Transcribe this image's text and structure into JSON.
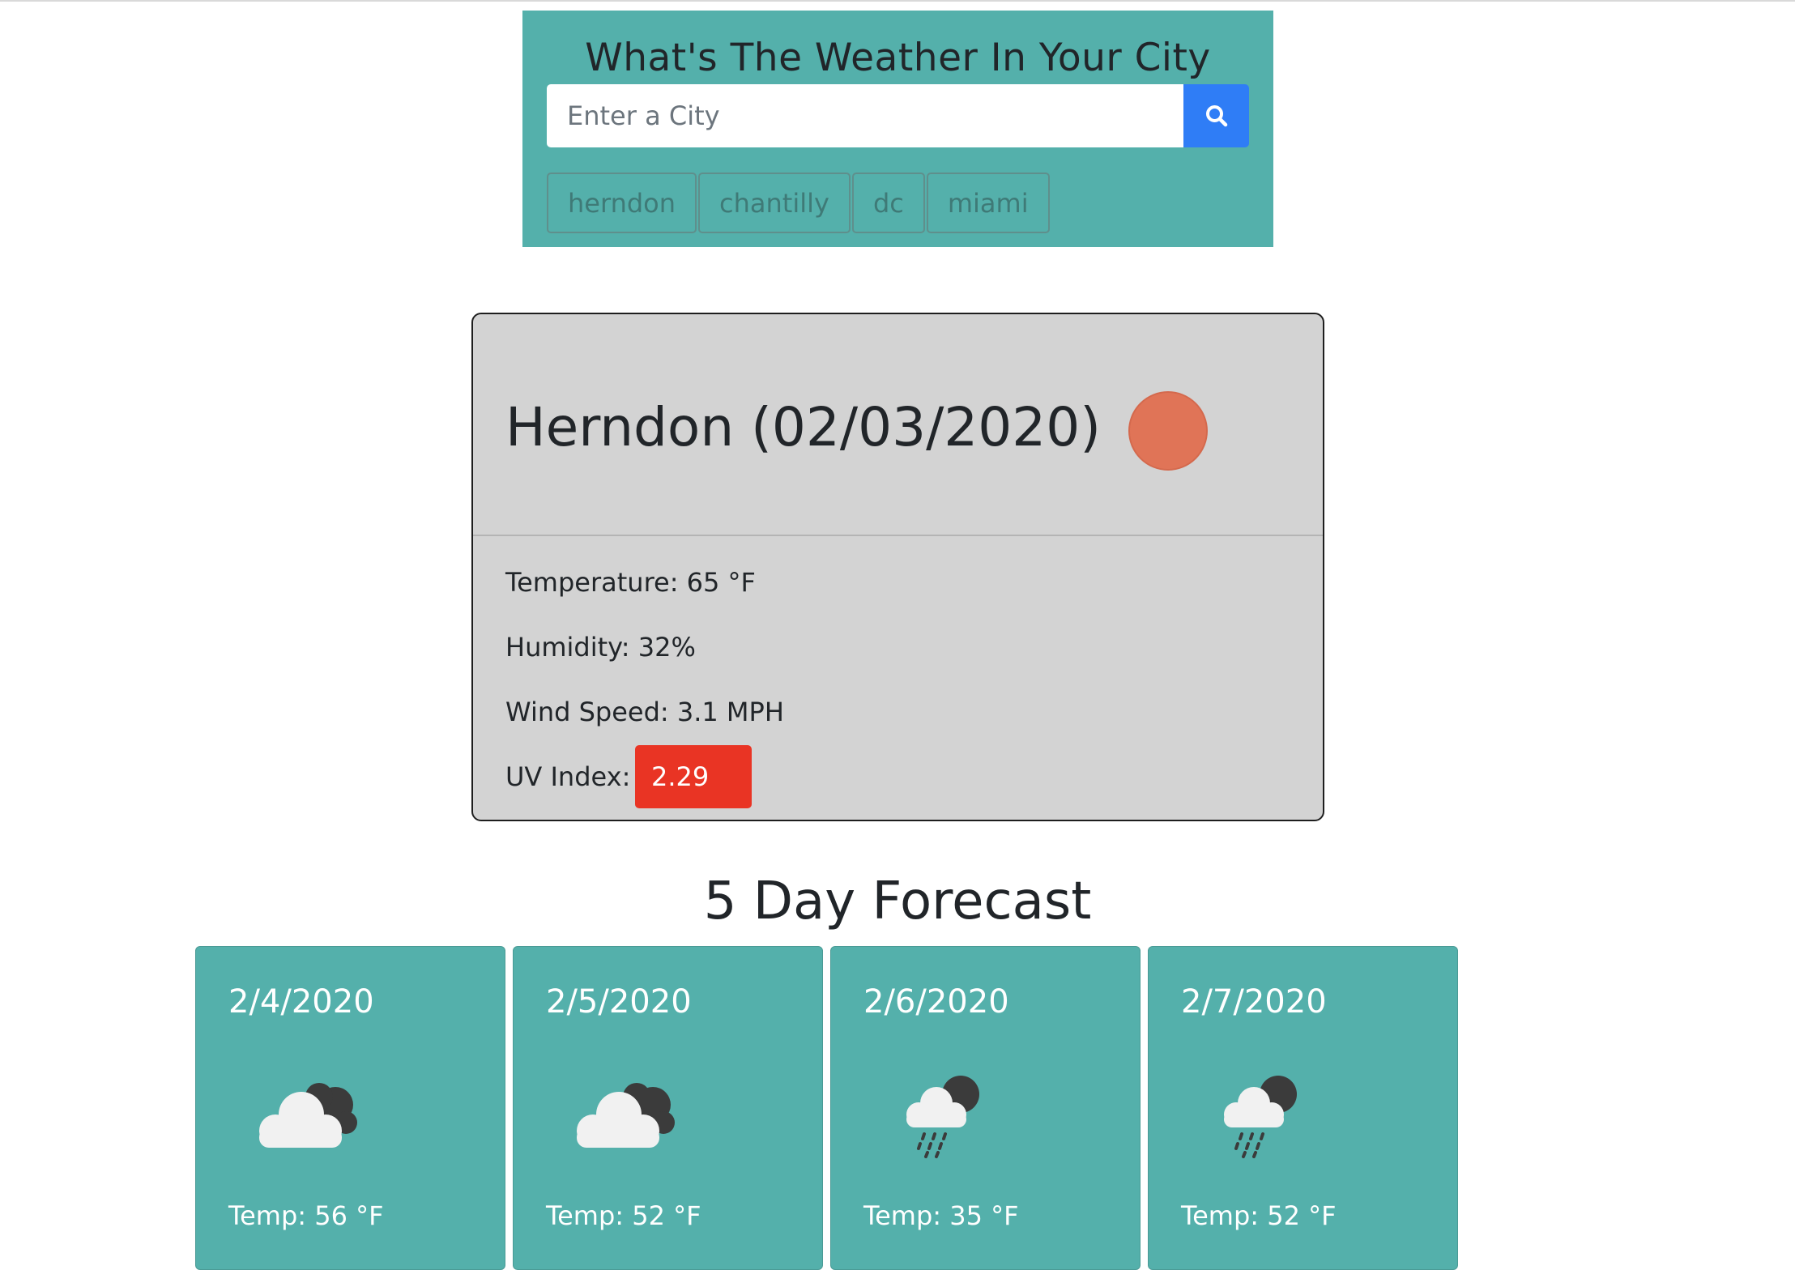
{
  "header": {
    "title": "What's The Weather In Your City",
    "search_placeholder": "Enter a City",
    "search_icon": "search-icon",
    "accent_color": "#54b0ab",
    "button_color": "#2f7df6"
  },
  "history": [
    "herndon",
    "chantilly",
    "dc",
    "miami"
  ],
  "current": {
    "title": "Herndon (02/03/2020)",
    "icon": "clear-sun-icon",
    "temperature": "Temperature: 65 °F",
    "humidity": "Humidity: 32%",
    "wind": "Wind Speed: 3.1 MPH",
    "uv_label": "UV Index:",
    "uv_value": "2.29",
    "uv_color": "#e93424"
  },
  "forecast": {
    "title": "5 Day Forecast",
    "days": [
      {
        "date": "2/4/2020",
        "icon": "cloudy-night-icon",
        "temp": "Temp: 56 °F"
      },
      {
        "date": "2/5/2020",
        "icon": "cloudy-night-icon",
        "temp": "Temp: 52 °F"
      },
      {
        "date": "2/6/2020",
        "icon": "rain-night-icon",
        "temp": "Temp: 35 °F"
      },
      {
        "date": "2/7/2020",
        "icon": "rain-night-icon",
        "temp": "Temp: 52 °F"
      }
    ]
  }
}
